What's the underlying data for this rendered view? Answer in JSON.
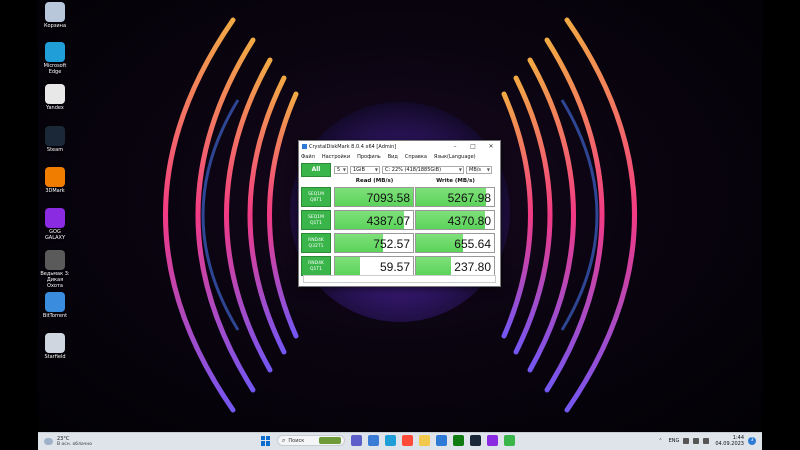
{
  "desktop": {
    "icons": [
      {
        "label": "Корзина",
        "icon": "recycle-bin-icon",
        "color": "#b8c7d9"
      },
      {
        "label": "Microsoft Edge",
        "icon": "edge-icon",
        "color": "#1f9ed8"
      },
      {
        "label": "Yandex",
        "icon": "yandex-icon",
        "color": "#e8e8e8"
      },
      {
        "label": "Steam",
        "icon": "steam-icon",
        "color": "#1b2838"
      },
      {
        "label": "3DMark",
        "icon": "3dmark-icon",
        "color": "#f07c00"
      },
      {
        "label": "GOG GALAXY",
        "icon": "gog-galaxy-icon",
        "color": "#8a2be2"
      },
      {
        "label": "Ведьмак 3: Дикая Охота",
        "icon": "witcher-icon",
        "color": "#5a5a5a"
      },
      {
        "label": "BitTorrent",
        "icon": "bittorrent-icon",
        "color": "#3a8dde"
      },
      {
        "label": "Starfield",
        "icon": "starfield-icon",
        "color": "#d0d6e0"
      }
    ]
  },
  "cdm": {
    "title": "CrystalDiskMark 8.0.4 x64 [Admin]",
    "menu": [
      "Файл",
      "Настройки",
      "Профиль",
      "Вид",
      "Справка",
      "Язык(Language)"
    ],
    "all_label": "All",
    "count": "5",
    "size": "1GiB",
    "drive": "C: 22% (418/1885GiB)",
    "unit": "MB/s",
    "read_header": "Read (MB/s)",
    "write_header": "Write (MB/s)",
    "tests": [
      {
        "l1": "SEQ1M",
        "l2": "Q8T1",
        "read": "7093.58",
        "write": "5267.98",
        "read_fill": 1.0,
        "write_fill": 0.9
      },
      {
        "l1": "SEQ1M",
        "l2": "Q1T1",
        "read": "4387.07",
        "write": "4370.80",
        "read_fill": 0.88,
        "write_fill": 0.88
      },
      {
        "l1": "RND4K",
        "l2": "Q32T1",
        "read": "752.57",
        "write": "655.64",
        "read_fill": 0.62,
        "write_fill": 0.6
      },
      {
        "l1": "RND4K",
        "l2": "Q1T1",
        "read": "59.57",
        "write": "237.80",
        "read_fill": 0.32,
        "write_fill": 0.45
      }
    ]
  },
  "taskbar": {
    "temp": "23°C",
    "condition": "В осн. облачно",
    "search_placeholder": "Поиск",
    "pinned": [
      {
        "icon": "chat-icon",
        "color": "#5b5fc7"
      },
      {
        "icon": "copilot-icon",
        "color": "#3a7bd5"
      },
      {
        "icon": "edge-icon",
        "color": "#1f9ed8"
      },
      {
        "icon": "yandex-browser-icon",
        "color": "#ff4b3a"
      },
      {
        "icon": "explorer-icon",
        "color": "#f2c94c"
      },
      {
        "icon": "store-icon",
        "color": "#2d7bd6"
      },
      {
        "icon": "xbox-icon",
        "color": "#107c10"
      },
      {
        "icon": "steam-icon",
        "color": "#1b2838"
      },
      {
        "icon": "gog-icon",
        "color": "#8a2be2"
      },
      {
        "icon": "crystaldiskmark-icon",
        "color": "#39b54a"
      }
    ],
    "lang": "ENG",
    "time": "1:44",
    "date": "04.09.2023",
    "notifications": "3"
  }
}
